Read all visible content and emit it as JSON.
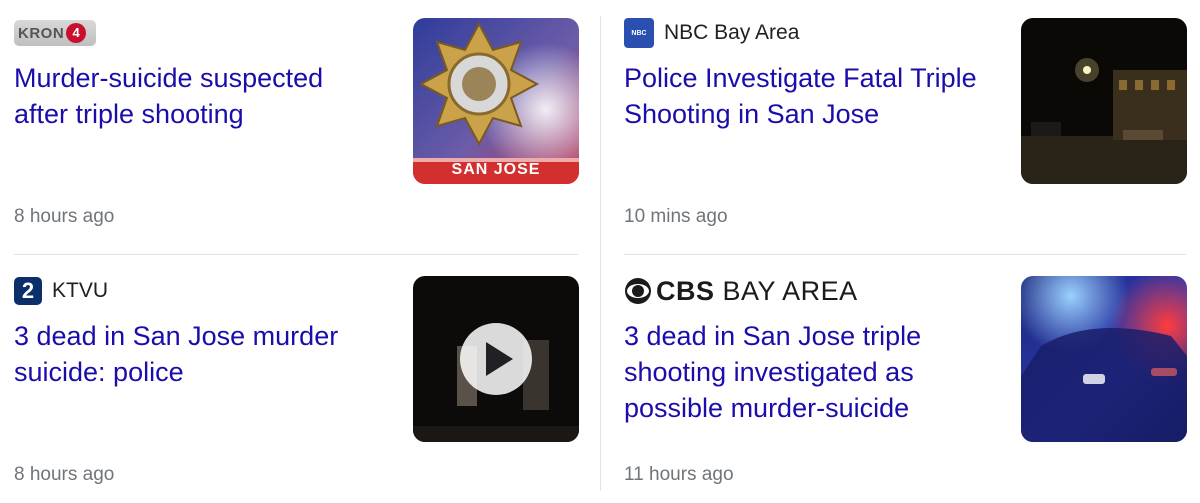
{
  "cards": [
    {
      "source": "KRON4",
      "logo_text": "KRON",
      "logo_badge": "4",
      "headline": "Murder-suicide suspected after triple shooting",
      "time": "8 hours ago",
      "thumb_caption": "SAN JOSE",
      "thumb_icon": "police-badge"
    },
    {
      "source": "NBC Bay Area",
      "logo_text": "NBC",
      "headline": "Police Investigate Fatal Triple Shooting in San Jose",
      "time": "10 mins ago",
      "thumb_icon": "night-street"
    },
    {
      "source": "KTVU",
      "logo_text": "2",
      "headline": "3 dead in San Jose murder suicide: police",
      "time": "8 hours ago",
      "thumb_icon": "play"
    },
    {
      "source": "CBS BAY AREA",
      "logo_text_bold": "CBS",
      "logo_text_rest": " BAY AREA",
      "headline": "3 dead in San Jose triple shooting investigated as possible murder-suicide",
      "time": "11 hours ago",
      "thumb_icon": "police-lights"
    }
  ],
  "colors": {
    "headline": "#1a0dab",
    "meta": "#70757a",
    "divider": "#e3e3e3"
  }
}
